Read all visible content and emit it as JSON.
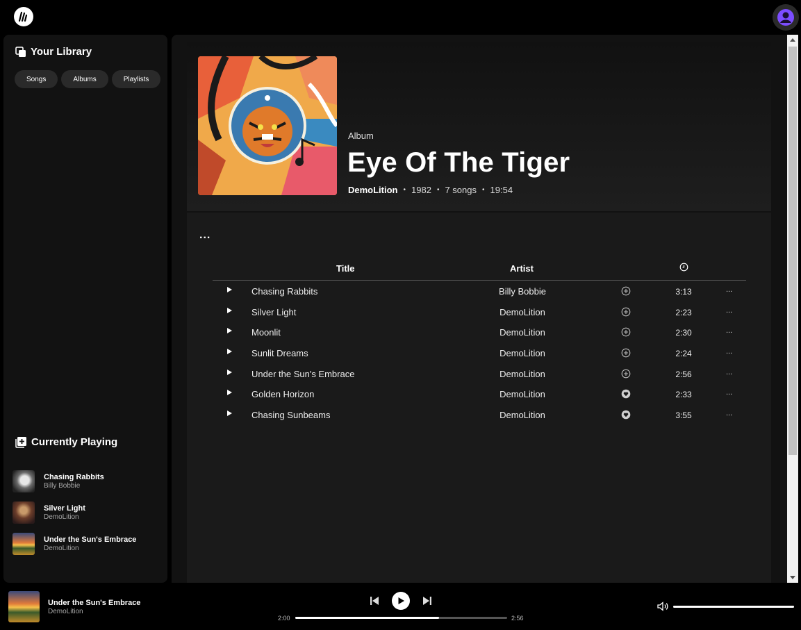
{
  "sidebar": {
    "library_title": "Your Library",
    "filters": [
      "Songs",
      "Albums",
      "Playlists"
    ],
    "currently_playing_title": "Currently Playing",
    "queue": [
      {
        "title": "Chasing Rabbits",
        "artist": "Billy Bobbie"
      },
      {
        "title": "Silver Light",
        "artist": "DemoLition"
      },
      {
        "title": "Under the Sun's Embrace",
        "artist": "DemoLition"
      }
    ]
  },
  "album": {
    "type_label": "Album",
    "title": "Eye Of The Tiger",
    "artist": "DemoLition",
    "year": "1982",
    "song_count": "7 songs",
    "duration": "19:54",
    "more_label": "..."
  },
  "table": {
    "headers": {
      "title": "Title",
      "artist": "Artist"
    },
    "tracks": [
      {
        "title": "Chasing Rabbits",
        "artist": "Billy Bobbie",
        "duration": "3:13",
        "action": "add-circle-icon",
        "options": "..."
      },
      {
        "title": "Silver Light",
        "artist": "DemoLition",
        "duration": "2:23",
        "action": "add-circle-icon",
        "options": "..."
      },
      {
        "title": "Moonlit",
        "artist": "DemoLition",
        "duration": "2:30",
        "action": "add-circle-icon",
        "options": "..."
      },
      {
        "title": "Sunlit Dreams",
        "artist": "DemoLition",
        "duration": "2:24",
        "action": "add-circle-icon",
        "options": "..."
      },
      {
        "title": "Under the Sun's Embrace",
        "artist": "DemoLition",
        "duration": "2:56",
        "action": "add-circle-icon",
        "options": "..."
      },
      {
        "title": "Golden Horizon",
        "artist": "DemoLition",
        "duration": "2:33",
        "action": "heart-filled-icon",
        "options": "..."
      },
      {
        "title": "Chasing Sunbeams",
        "artist": "DemoLition",
        "duration": "3:55",
        "action": "heart-filled-icon",
        "options": "..."
      }
    ]
  },
  "player": {
    "title": "Under the Sun's Embrace",
    "artist": "DemoLition",
    "current_time": "2:00",
    "total_time": "2:56",
    "progress": 0.68,
    "volume": 1.0
  },
  "colors": {
    "background": "#000000",
    "panel": "#121212",
    "content": "#1a1a1a",
    "avatar_accent": "#7c4dff"
  }
}
